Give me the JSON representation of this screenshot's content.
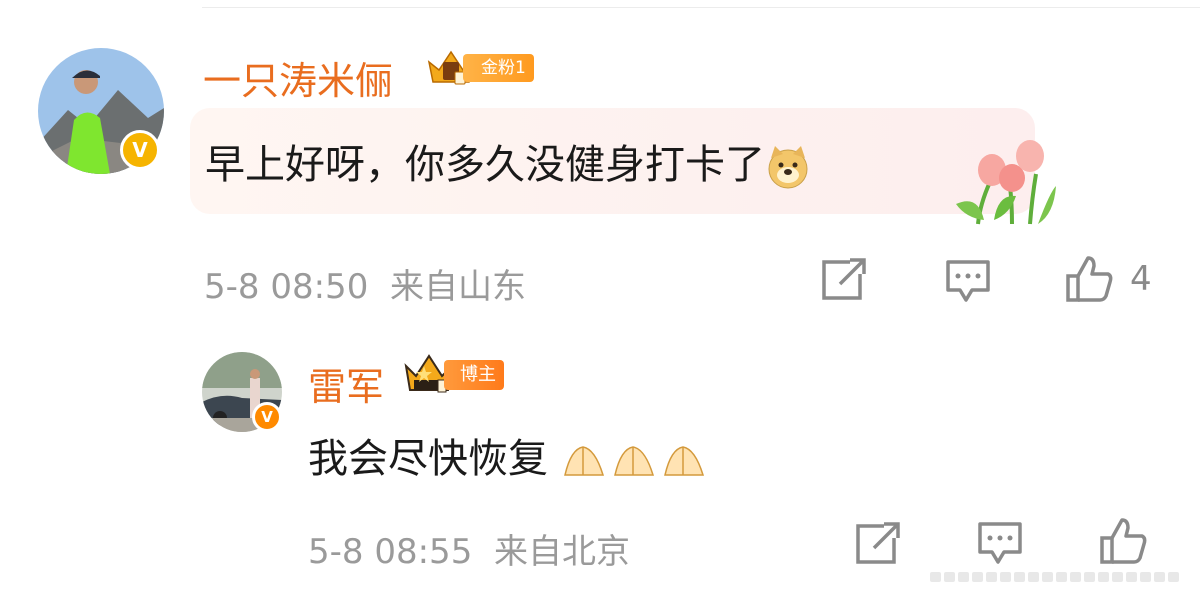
{
  "comment": {
    "username": "一只涛米俪",
    "badge_label": "金粉1",
    "text": "早上好呀，你多久没健身打卡了",
    "date": "5-8 08:50",
    "location": "来自山东",
    "like_count": "4"
  },
  "reply": {
    "username": "雷军",
    "badge_label": "博主",
    "text": "我会尽快恢复",
    "date": "5-8 08:55",
    "location": "来自北京"
  },
  "colors": {
    "username": "#e96d1f",
    "meta": "#9a9a9a",
    "badge_gold": "#f6b400"
  }
}
